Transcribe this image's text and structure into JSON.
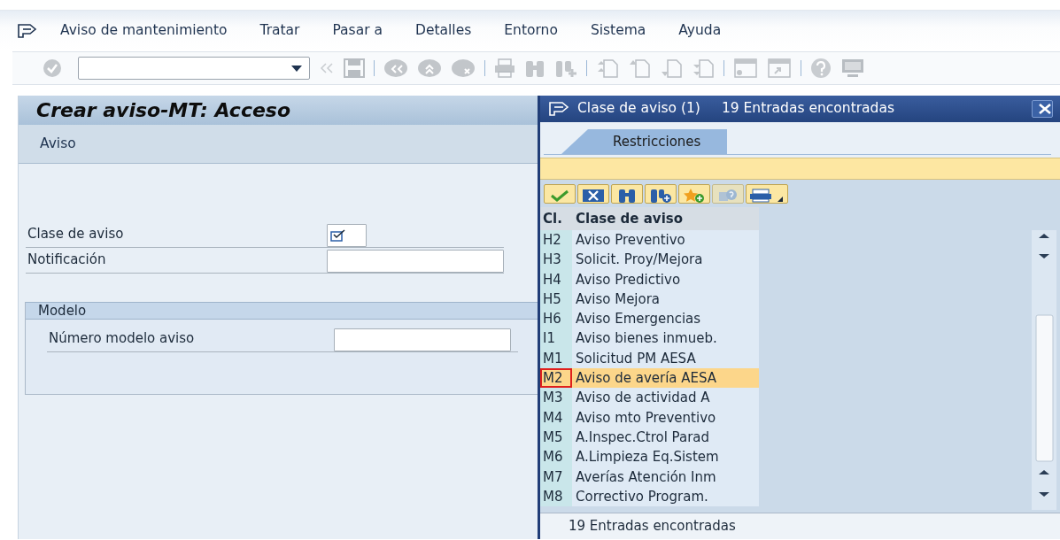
{
  "menu_bar": {
    "items": [
      {
        "label": "Aviso de mantenimiento"
      },
      {
        "label": "Tratar"
      },
      {
        "label": "Pasar a"
      },
      {
        "label": "Detalles"
      },
      {
        "label": "Entorno"
      },
      {
        "label": "Sistema"
      },
      {
        "label": "Ayuda"
      }
    ]
  },
  "screen": {
    "title": "Crear aviso-MT: Acceso",
    "application_toolbar": {
      "label": "Aviso"
    },
    "fields": [
      {
        "label": "Clase de aviso",
        "required": true
      },
      {
        "label": "Notificación",
        "required": false
      }
    ],
    "group": {
      "title": "Modelo",
      "fields": [
        {
          "label": "Número modelo aviso",
          "required": false
        }
      ]
    }
  },
  "popup": {
    "title": "Clase de aviso (1)",
    "subtitle": "19 Entradas encontradas",
    "tabs": [
      {
        "label": "Restricciones",
        "selected": true
      }
    ],
    "columns": [
      "Cl.",
      "Clase de aviso"
    ],
    "rows": [
      {
        "code": "H2",
        "text": "Aviso Preventivo",
        "selected": false
      },
      {
        "code": "H3",
        "text": "Solicit. Proy/Mejora",
        "selected": false
      },
      {
        "code": "H4",
        "text": "Aviso Predictivo",
        "selected": false
      },
      {
        "code": "H5",
        "text": "Aviso Mejora",
        "selected": false
      },
      {
        "code": "H6",
        "text": "Aviso Emergencias",
        "selected": false
      },
      {
        "code": "I1",
        "text": "Aviso bienes inmueb.",
        "selected": false
      },
      {
        "code": "M1",
        "text": "Solicitud PM AESA",
        "selected": false
      },
      {
        "code": "M2",
        "text": "Aviso de avería AESA",
        "selected": true
      },
      {
        "code": "M3",
        "text": "Aviso de actividad A",
        "selected": false
      },
      {
        "code": "M4",
        "text": "Aviso mto Preventivo",
        "selected": false
      },
      {
        "code": "M5",
        "text": "A.Inspec.Ctrol Parad",
        "selected": false
      },
      {
        "code": "M6",
        "text": "A.Limpieza Eq.Sistem",
        "selected": false
      },
      {
        "code": "M7",
        "text": "Averías Atención Inm",
        "selected": false
      },
      {
        "code": "M8",
        "text": "Correctivo Program.",
        "selected": false
      }
    ],
    "status": "19 Entradas encontradas"
  }
}
